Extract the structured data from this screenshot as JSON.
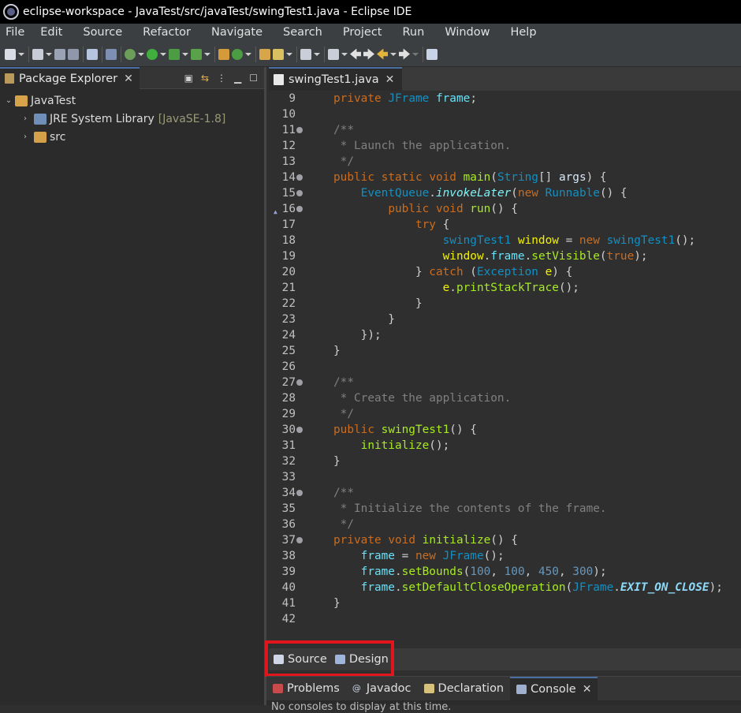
{
  "titlebar": {
    "title": "eclipse-workspace - JavaTest/src/javaTest/swingTest1.java - Eclipse IDE"
  },
  "menu": [
    "File",
    "Edit",
    "Source",
    "Refactor",
    "Navigate",
    "Search",
    "Project",
    "Run",
    "Window",
    "Help"
  ],
  "package_explorer": {
    "tab_label": "Package Explorer",
    "items": [
      {
        "label": "JavaTest",
        "suffix": ""
      },
      {
        "label": "JRE System Library",
        "suffix": "[JavaSE-1.8]"
      },
      {
        "label": "src",
        "suffix": ""
      }
    ]
  },
  "editor": {
    "tab_label": "swingTest1.java",
    "lines": [
      {
        "n": "9",
        "html": "<span class=\"kw\">private</span> <span class=\"ty\">JFrame</span> <span class=\"fd\">frame</span>;"
      },
      {
        "n": "10",
        "html": ""
      },
      {
        "n": "11",
        "html": "<span class=\"cm\">/**</span>"
      },
      {
        "n": "12",
        "html": "<span class=\"cm\"> * Launch the application.</span>"
      },
      {
        "n": "13",
        "html": "<span class=\"cm\"> */</span>"
      },
      {
        "n": "14",
        "html": "<span class=\"kw\">public</span> <span class=\"kw\">static</span> <span class=\"kw\">void</span> <span class=\"mt\">main</span>(<span class=\"ty\">String</span>[] <span class=\"pl\">args</span>) {"
      },
      {
        "n": "15",
        "html": "    <span class=\"ty\">EventQueue</span>.<span class=\"it\">invokeLater</span>(<span class=\"kw\">new</span> <span class=\"ty\">Runnable</span>() {"
      },
      {
        "n": "16",
        "html": "        <span class=\"kw\">public</span> <span class=\"kw\">void</span> <span class=\"mt\">run</span>() {"
      },
      {
        "n": "17",
        "html": "            <span class=\"kw\">try</span> {"
      },
      {
        "n": "18",
        "html": "                <span class=\"ty\">swingTest1</span> <span class=\"lv\">window</span> = <span class=\"kw\">new</span> <span class=\"ty\">swingTest1</span>();"
      },
      {
        "n": "19",
        "html": "                <span class=\"lv\">window</span>.<span class=\"fd\">frame</span>.<span class=\"mt\">setVisible</span>(<span class=\"kw\">true</span>);"
      },
      {
        "n": "20",
        "html": "            } <span class=\"kw\">catch</span> (<span class=\"ty\">Exception</span> <span class=\"lv\">e</span>) {"
      },
      {
        "n": "21",
        "html": "                <span class=\"lv\">e</span>.<span class=\"mt\">printStackTrace</span>();"
      },
      {
        "n": "22",
        "html": "            }"
      },
      {
        "n": "23",
        "html": "        }"
      },
      {
        "n": "24",
        "html": "    });"
      },
      {
        "n": "25",
        "html": "}"
      },
      {
        "n": "26",
        "html": ""
      },
      {
        "n": "27",
        "html": "<span class=\"cm\">/**</span>"
      },
      {
        "n": "28",
        "html": "<span class=\"cm\"> * Create the application.</span>"
      },
      {
        "n": "29",
        "html": "<span class=\"cm\"> */</span>"
      },
      {
        "n": "30",
        "html": "<span class=\"kw\">public</span> <span class=\"mt\">swingTest1</span>() {"
      },
      {
        "n": "31",
        "html": "    <span class=\"mt\">initialize</span>();"
      },
      {
        "n": "32",
        "html": "}"
      },
      {
        "n": "33",
        "html": ""
      },
      {
        "n": "34",
        "html": "<span class=\"cm\">/**</span>"
      },
      {
        "n": "35",
        "html": "<span class=\"cm\"> * Initialize the contents of the frame.</span>"
      },
      {
        "n": "36",
        "html": "<span class=\"cm\"> */</span>"
      },
      {
        "n": "37",
        "html": "<span class=\"kw\">private</span> <span class=\"kw\">void</span> <span class=\"mt\">initialize</span>() {"
      },
      {
        "n": "38",
        "html": "    <span class=\"fd\">frame</span> = <span class=\"kw\">new</span> <span class=\"ty\">JFrame</span>();"
      },
      {
        "n": "39",
        "html": "    <span class=\"fd\">frame</span>.<span class=\"mt\">setBounds</span>(<span class=\"nm\">100</span>, <span class=\"nm\">100</span>, <span class=\"nm\">450</span>, <span class=\"nm\">300</span>);"
      },
      {
        "n": "40",
        "html": "    <span class=\"fd\">frame</span>.<span class=\"mt\">setDefaultCloseOperation</span>(<span class=\"ty\">JFrame</span>.<span class=\"cst\">EXIT_ON_CLOSE</span>);"
      },
      {
        "n": "41",
        "html": "}"
      },
      {
        "n": "42",
        "html": ""
      }
    ],
    "fold_markers": [
      "11",
      "14",
      "15",
      "16",
      "27",
      "30",
      "34",
      "37"
    ]
  },
  "design_tabs": {
    "source": "Source",
    "design": "Design"
  },
  "bottom_panel": {
    "tabs": [
      "Problems",
      "Javadoc",
      "Declaration",
      "Console"
    ],
    "active": "Console",
    "message": "No consoles to display at this time."
  }
}
